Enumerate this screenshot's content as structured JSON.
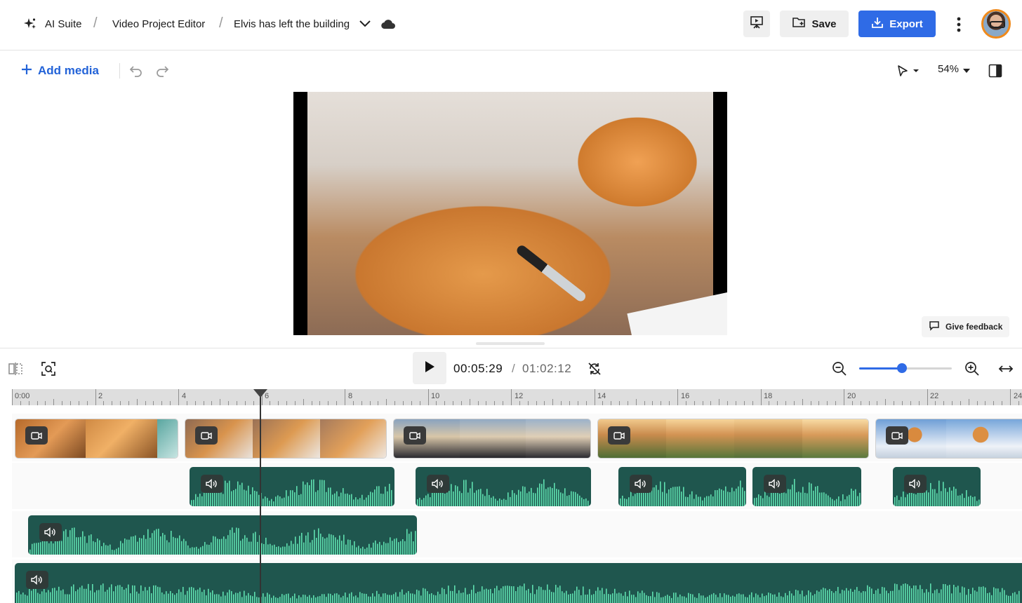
{
  "breadcrumb": {
    "suite": "AI Suite",
    "editor": "Video Project Editor",
    "project": "Elvis has left the building",
    "separator": "/"
  },
  "header": {
    "save_label": "Save",
    "export_label": "Export"
  },
  "toolbar": {
    "add_media_label": "Add media",
    "zoom_level": "54%"
  },
  "feedback": {
    "label": "Give feedback"
  },
  "playback": {
    "current_time": "00:05:29",
    "separator": "/",
    "total_time": "01:02:12"
  },
  "timeline_zoom": {
    "level": 0.46
  },
  "ruler": {
    "labels": [
      "0:00",
      "2",
      "4",
      "6",
      "8",
      "10",
      "12",
      "14",
      "16",
      "18",
      "20",
      "22",
      "24"
    ]
  },
  "colors": {
    "accent": "#2f6be6",
    "audio_clip": "#1f564e",
    "waveform": "#5fe0b0",
    "avatar_ring": "#f08a1c"
  },
  "icons": {
    "suite": "sparkle-icon",
    "cloud": "cloud-icon",
    "present": "present-icon",
    "save": "folder-plus-icon",
    "export": "download-icon",
    "more": "more-vertical-icon",
    "undo": "undo-icon",
    "redo": "redo-icon",
    "select": "cursor-icon",
    "panel": "panel-toggle-icon",
    "split": "split-icon",
    "focus": "focus-icon",
    "play": "play-icon",
    "sync": "sync-off-icon",
    "zoom_out": "zoom-out-icon",
    "zoom_in": "zoom-in-icon",
    "fit": "fit-width-icon",
    "video": "video-camera-icon",
    "audio": "speaker-icon"
  }
}
